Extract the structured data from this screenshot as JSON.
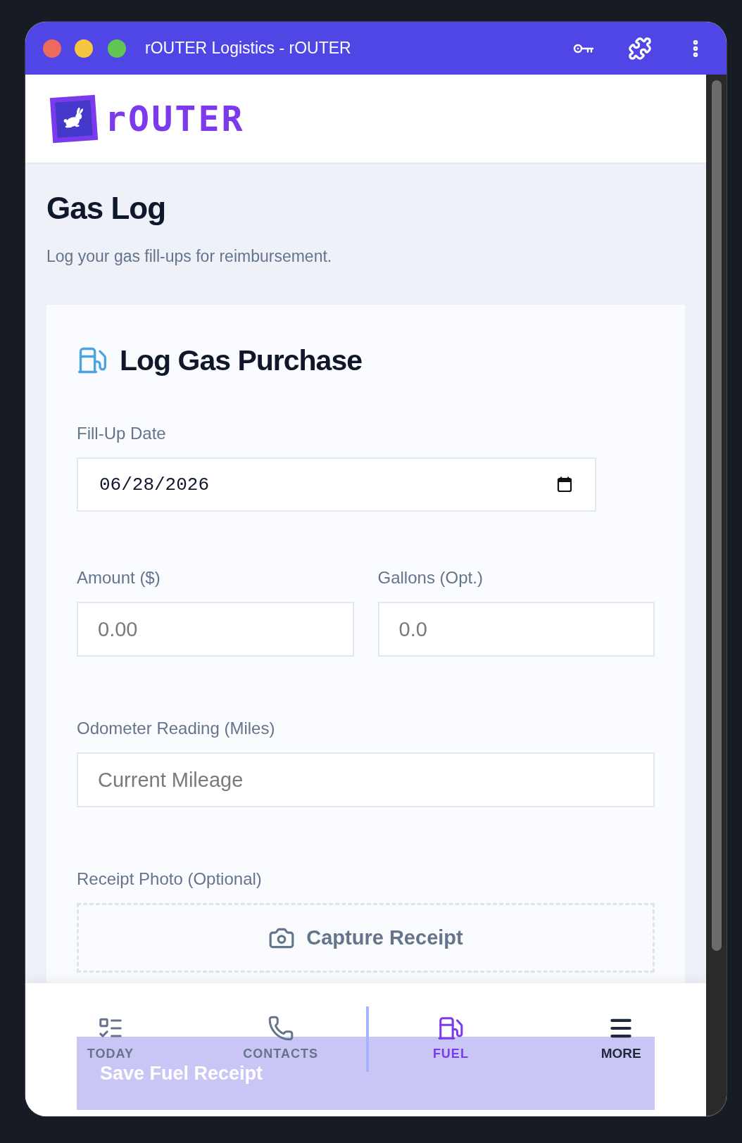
{
  "window": {
    "title": "rOUTER Logistics - rOUTER"
  },
  "header": {
    "logo_text": "rOUTER"
  },
  "page": {
    "title": "Gas Log",
    "subtitle": "Log your gas fill-ups for reimbursement."
  },
  "form": {
    "title": "Log Gas Purchase",
    "date_field": {
      "label": "Fill-Up Date",
      "value": "06/28/2026"
    },
    "amount_field": {
      "label": "Amount ($)",
      "placeholder": "0.00"
    },
    "gallons_field": {
      "label": "Gallons (Opt.)",
      "placeholder": "0.0"
    },
    "odometer_field": {
      "label": "Odometer Reading (Miles)",
      "placeholder": "Current Mileage"
    },
    "receipt": {
      "label": "Receipt Photo (Optional)",
      "button": "Capture Receipt"
    },
    "submit_button": "Save Fuel Receipt"
  },
  "bottom_nav": [
    {
      "label": "TODAY",
      "kind": "tab",
      "selected": false
    },
    {
      "label": "CONTACTS",
      "kind": "tab",
      "selected": false
    },
    {
      "label": "FUEL",
      "kind": "tab",
      "selected": true
    },
    {
      "label": "MORE",
      "kind": "menu",
      "selected": false
    }
  ]
}
